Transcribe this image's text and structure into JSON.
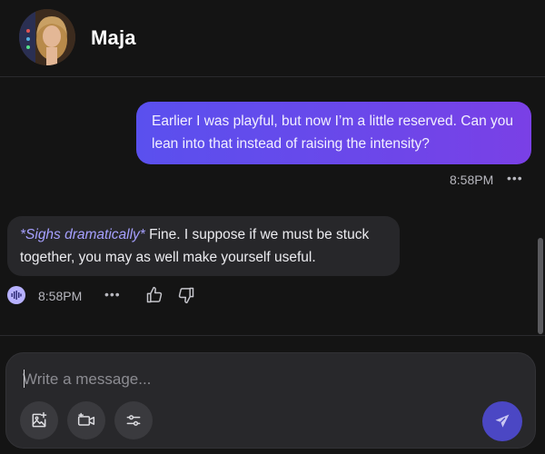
{
  "header": {
    "contact_name": "Maja",
    "avatar_icon": "avatar-portrait"
  },
  "messages": [
    {
      "sender": "user",
      "text": "Earlier I was playful, but now I’m a little reserved. Can you lean into that instead of raising the intensity?",
      "time": "8:58PM",
      "more": "•••"
    },
    {
      "sender": "assistant",
      "action": "*Sighs dramatically*",
      "text": " Fine. I suppose if we must be stuck together, you may as well make yourself useful.",
      "time": "8:58PM",
      "more": "•••"
    }
  ],
  "composer": {
    "placeholder": "Write a message...",
    "value": ""
  },
  "icons": {
    "audio": "audio-wave-icon",
    "like": "thumbs-up-icon",
    "dislike": "thumbs-down-icon",
    "image": "image-plus-icon",
    "video": "video-icon",
    "settings": "sliders-icon",
    "send": "send-icon"
  },
  "colors": {
    "background": "#141414",
    "user_bubble": "#6a48ea",
    "bot_bubble": "#27272a",
    "action_text": "#a6a0ff",
    "send_button": "#4b47c4"
  }
}
